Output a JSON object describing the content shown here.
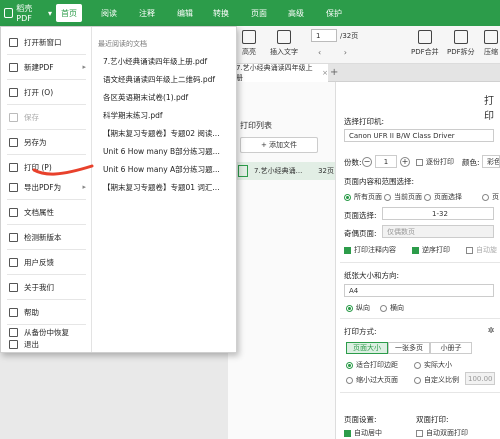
{
  "app": {
    "button_label": "稻壳PDF",
    "caret": "▾"
  },
  "menu_tabs": [
    {
      "label": "首页",
      "active": true
    },
    {
      "label": "阅读",
      "active": false
    },
    {
      "label": "注释",
      "active": false
    },
    {
      "label": "编辑",
      "active": false
    },
    {
      "label": "转换",
      "active": false
    },
    {
      "label": "页面",
      "active": false
    },
    {
      "label": "高级",
      "active": false
    },
    {
      "label": "保护",
      "active": false
    }
  ],
  "toolbar": {
    "highlight": "高亮",
    "insert_text": "插入文字",
    "page_current": "1",
    "page_total": "/32页",
    "merge": "PDF合并",
    "split": "PDF拆分",
    "compress": "压缩"
  },
  "doc_tab": {
    "title": "7.艺小经典诵读四年级上册",
    "close": "×",
    "add": "+"
  },
  "print_list": {
    "title": "打印列表",
    "add_file": "+ 添加文件",
    "file_name": "7.艺小经典诵...",
    "file_pages": "32页"
  },
  "print_settings": {
    "title": "打印",
    "select_printer_label": "选择打印机:",
    "printer": "Canon UFR II B/W Class Driver",
    "copies_label": "份数:",
    "copies_value": "1",
    "collate_label": "逐份打印",
    "color_label": "颜色:",
    "color_value": "彩色",
    "range_label": "页面内容和范围选择:",
    "range_options": [
      "所有页面",
      "当前页面",
      "页面选择",
      "页"
    ],
    "page_select_label": "页面选择:",
    "page_select_value": "1-32",
    "odd_even_label": "奇偶页面:",
    "odd_even_value": "仅偶数页",
    "print_comments": "打印注释内容",
    "reverse_print": "逆序打印",
    "auto_rotate": "自动旋",
    "paper_label": "纸张大小和方向:",
    "paper_size": "A4",
    "portrait": "纵向",
    "landscape": "横向",
    "mode_label": "打印方式:",
    "mode_tabs": [
      "页面大小",
      "一张多页",
      "小册子"
    ],
    "fit_margin": "适合打印边距",
    "actual_size": "实际大小",
    "shrink_large": "缩小过大页面",
    "custom_scale": "自定义比例",
    "scale_value": "100.00",
    "page_settings_label": "页面设置:",
    "auto_center": "自动居中",
    "duplex_label": "双面打印:",
    "auto_duplex": "自动双面打印"
  },
  "file_menu": {
    "items": [
      {
        "label": "打开新窗口",
        "icon": "new-window-icon",
        "disabled": false
      },
      {
        "label": "新建PDF",
        "icon": "new-pdf-icon",
        "disabled": false,
        "submenu": true
      },
      {
        "label": "打开 (O)",
        "icon": "open-icon",
        "disabled": false
      },
      {
        "label": "保存",
        "icon": "save-icon",
        "disabled": true
      },
      {
        "label": "另存为",
        "icon": "save-as-icon",
        "disabled": false
      },
      {
        "label": "打印 (P)",
        "icon": "print-icon",
        "disabled": false
      },
      {
        "label": "导出PDF为",
        "icon": "export-icon",
        "disabled": false,
        "submenu": true
      },
      {
        "label": "文档属性",
        "icon": "properties-icon",
        "disabled": false
      },
      {
        "label": "检测新版本",
        "icon": "update-icon",
        "disabled": false
      },
      {
        "label": "用户反馈",
        "icon": "feedback-icon",
        "disabled": false
      },
      {
        "label": "关于我们",
        "icon": "about-icon",
        "disabled": false
      },
      {
        "label": "帮助",
        "icon": "help-icon",
        "disabled": false
      },
      {
        "label": "从备份中恢复",
        "icon": "restore-icon",
        "disabled": false
      },
      {
        "label": "退出",
        "icon": "exit-icon",
        "disabled": false
      }
    ],
    "recent_title": "最近阅读的文档",
    "recent": [
      "7.艺小经典诵读四年级上册.pdf",
      "语文经典诵读四年级上二维码.pdf",
      "各区英语期末试卷(1).pdf",
      "科学期末练习.pdf",
      "【期末复习专题卷】专题02 阅读...",
      "Unit 6 How many B部分练习题...",
      "Unit 6 How many A部分练习题...",
      "【期末复习专题卷】专题01 词汇..."
    ]
  },
  "colors": {
    "brand": "#2c9c4a",
    "annotation": "#e8412c"
  }
}
